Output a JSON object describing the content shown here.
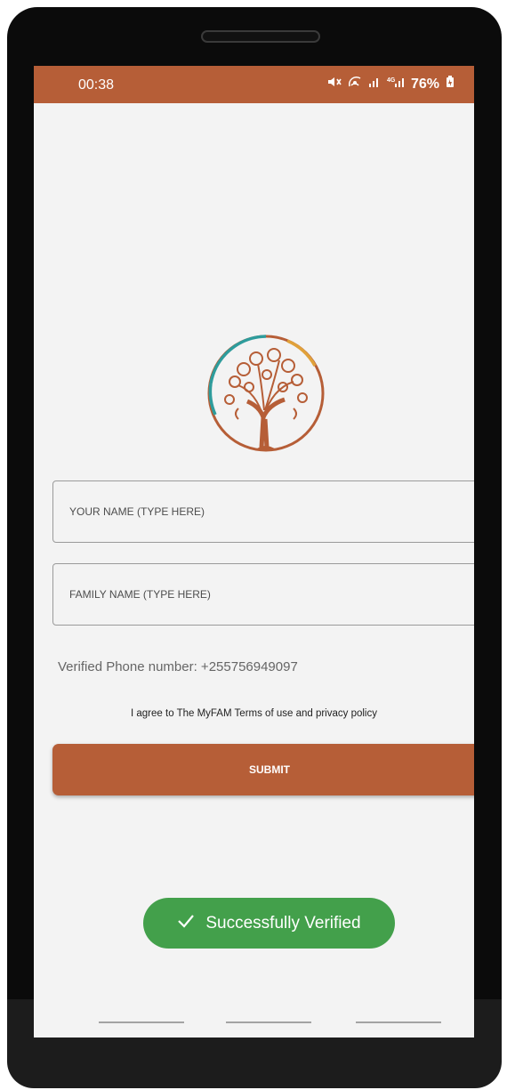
{
  "status_bar": {
    "time": "00:38",
    "battery": "76%",
    "color": "#b65e37"
  },
  "form": {
    "name_placeholder": "YOUR NAME (TYPE HERE)",
    "family_placeholder": "FAMILY NAME (TYPE HERE)",
    "verified_phone": "Verified Phone number: +255756949097",
    "agree_text": "I agree to The MyFAM Terms of use and privacy policy",
    "submit_label": "SUBMIT"
  },
  "toast": {
    "icon": "check-icon",
    "text": "Successfully Verified",
    "color": "#43a04b"
  }
}
